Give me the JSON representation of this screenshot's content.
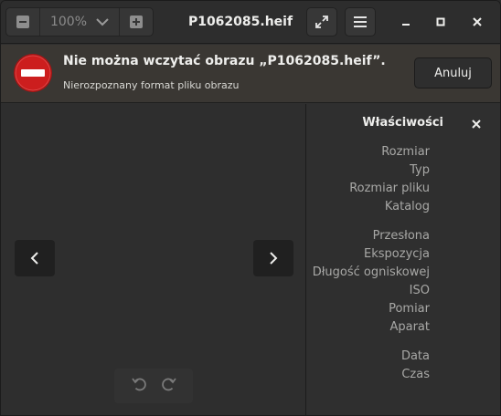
{
  "header": {
    "zoom_level": "100%",
    "title": "P1062085.heif",
    "icons": {
      "zoom_out": "zoom-out-icon",
      "zoom_in": "zoom-in-icon",
      "fullscreen": "fullscreen-icon",
      "menu": "hamburger-menu-icon",
      "minimize": "minimize-icon",
      "maximize": "maximize-icon",
      "close": "close-icon"
    }
  },
  "infobar": {
    "title": "Nie można wczytać obrazu „P1062085.heif”.",
    "subtitle": "Nierozpoznany format pliku obrazu",
    "cancel_label": "Anuluj",
    "icon": "error-stop-icon",
    "icon_color": "#cc1e1e"
  },
  "sidebar": {
    "title": "Właściwości",
    "groups": [
      [
        "Rozmiar",
        "Typ",
        "Rozmiar pliku",
        "Katalog"
      ],
      [
        "Przesłona",
        "Ekspozycja",
        "Długość ogniskowej",
        "ISO",
        "Pomiar",
        "Aparat"
      ],
      [
        "Data",
        "Czas"
      ]
    ]
  },
  "colors": {
    "headerbar": "#2d2d2d",
    "infobar": "#3a3733",
    "window_bg": "#2e2e2e",
    "text": "#eeeeec",
    "muted_text": "#a8a8a6"
  }
}
